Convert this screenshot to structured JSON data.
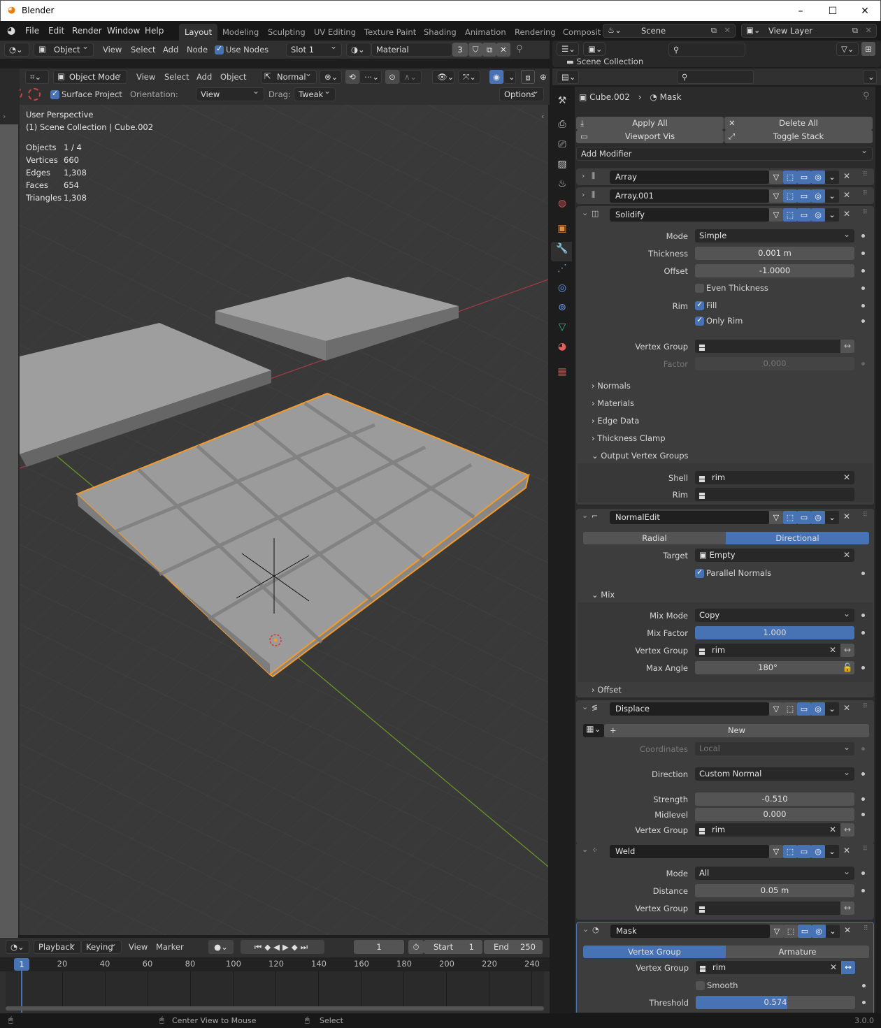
{
  "window": {
    "title": "Blender",
    "minimize": "–",
    "maximize": "☐",
    "close": "✕"
  },
  "menubar": {
    "items": [
      "File",
      "Edit",
      "Render",
      "Window",
      "Help"
    ],
    "workspaces": [
      "Layout",
      "Modeling",
      "Sculpting",
      "UV Editing",
      "Texture Paint",
      "Shading",
      "Animation",
      "Rendering",
      "Composit"
    ],
    "active_workspace": "Layout",
    "scene": "Scene",
    "view_layer": "View Layer"
  },
  "shader_header": {
    "object_mode": "Object",
    "menus": [
      "View",
      "Select",
      "Add",
      "Node"
    ],
    "use_nodes_label": "Use Nodes",
    "use_nodes_checked": true,
    "slot": "Slot 1",
    "material": "Material",
    "users": "3"
  },
  "outliner": {
    "search_placeholder": "",
    "scene_collection": "Scene Collection"
  },
  "viewport_header": {
    "mode": "Object Mode",
    "menus": [
      "View",
      "Select",
      "Add",
      "Object"
    ],
    "orientation_pivot": "Normal",
    "surface_project_label": "Surface Project",
    "surface_project_checked": true,
    "orientation_label": "Orientation:",
    "orientation_value": "View",
    "drag_label": "Drag:",
    "drag_value": "Tweak",
    "options": "Options"
  },
  "viewport_overlay": {
    "view_name": "User Perspective",
    "collection_info": "(1) Scene Collection | Cube.002",
    "stats": [
      {
        "label": "Objects",
        "value": "1 / 4"
      },
      {
        "label": "Vertices",
        "value": "660"
      },
      {
        "label": "Edges",
        "value": "1,308"
      },
      {
        "label": "Faces",
        "value": "654"
      },
      {
        "label": "Triangles",
        "value": "1,308"
      }
    ]
  },
  "properties": {
    "breadcrumb_object": "Cube.002",
    "breadcrumb_modifier": "Mask",
    "apply_all": "Apply All",
    "delete_all": "Delete All",
    "viewport_vis": "Viewport Vis",
    "toggle_stack": "Toggle Stack",
    "add_modifier": "Add Modifier",
    "modifiers": {
      "array": {
        "name": "Array"
      },
      "array001": {
        "name": "Array.001"
      },
      "solidify": {
        "name": "Solidify",
        "mode_label": "Mode",
        "mode": "Simple",
        "thickness_label": "Thickness",
        "thickness": "0.001 m",
        "offset_label": "Offset",
        "offset": "-1.0000",
        "even_thickness": "Even Thickness",
        "even_thickness_checked": false,
        "rim_label": "Rim",
        "fill": "Fill",
        "fill_checked": true,
        "only_rim": "Only Rim",
        "only_rim_checked": true,
        "vertex_group_label": "Vertex Group",
        "vertex_group": "",
        "factor_label": "Factor",
        "factor": "0.000",
        "subpanels": [
          "Normals",
          "Materials",
          "Edge Data",
          "Thickness Clamp",
          "Output Vertex Groups"
        ],
        "shell_label": "Shell",
        "shell": "rim",
        "rim_vg_label": "Rim",
        "rim_vg": ""
      },
      "normaledit": {
        "name": "NormalEdit",
        "radial": "Radial",
        "directional": "Directional",
        "active_mode": "Directional",
        "target_label": "Target",
        "target": "Empty",
        "parallel_normals": "Parallel Normals",
        "parallel_checked": true,
        "mix_panel": "Mix",
        "mix_mode_label": "Mix Mode",
        "mix_mode": "Copy",
        "mix_factor_label": "Mix Factor",
        "mix_factor": "1.000",
        "mix_factor_fraction": 1.0,
        "vertex_group_label": "Vertex Group",
        "vertex_group": "rim",
        "max_angle_label": "Max Angle",
        "max_angle": "180°",
        "offset_panel": "Offset"
      },
      "displace": {
        "name": "Displace",
        "new_texture": "New",
        "coordinates_label": "Coordinates",
        "coordinates": "Local",
        "direction_label": "Direction",
        "direction": "Custom Normal",
        "strength_label": "Strength",
        "strength": "-0.510",
        "midlevel_label": "Midlevel",
        "midlevel": "0.000",
        "vertex_group_label": "Vertex Group",
        "vertex_group": "rim"
      },
      "weld": {
        "name": "Weld",
        "mode_label": "Mode",
        "mode": "All",
        "distance_label": "Distance",
        "distance": "0.05 m",
        "vertex_group_label": "Vertex Group",
        "vertex_group": ""
      },
      "mask": {
        "name": "Mask",
        "vertex_group_tab": "Vertex Group",
        "armature_tab": "Armature",
        "active_mode": "Vertex Group",
        "vertex_group_label": "Vertex Group",
        "vertex_group": "rim",
        "smooth": "Smooth",
        "smooth_checked": false,
        "threshold_label": "Threshold",
        "threshold": "0.574",
        "threshold_fraction": 0.574
      }
    }
  },
  "timeline": {
    "menus": [
      "Playback",
      "Keying",
      "View",
      "Marker"
    ],
    "current_frame": "1",
    "start_label": "Start",
    "start": "1",
    "end_label": "End",
    "end": "250",
    "ticks": [
      "20",
      "40",
      "60",
      "80",
      "100",
      "120",
      "140",
      "160",
      "180",
      "200",
      "220",
      "240"
    ],
    "playhead": "1"
  },
  "statusbar": {
    "hint_middle": "Center View to Mouse",
    "hint_right": "Select",
    "version": "3.0.0"
  },
  "colors": {
    "accent": "#4772b3",
    "selection_outline": "#f39a2b",
    "x_axis": "#a43a48",
    "y_axis": "#6a9a26"
  }
}
